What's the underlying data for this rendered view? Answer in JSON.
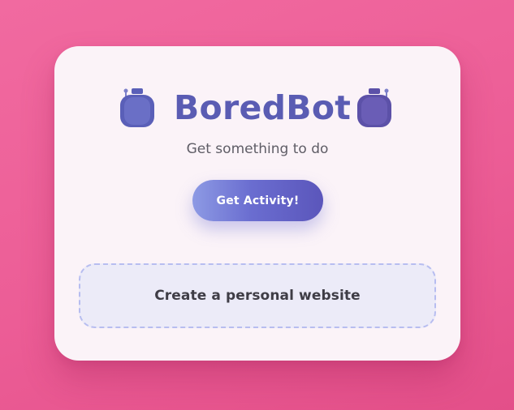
{
  "app": {
    "title": "BoredBot",
    "subtitle": "Get something to do"
  },
  "icons": {
    "left": "robot-icon",
    "right": "robot-icon"
  },
  "actions": {
    "get_activity_label": "Get Activity!"
  },
  "activity": {
    "text": "Create a personal website"
  },
  "colors": {
    "background": "#ec5d96",
    "card": "#fbf3f8",
    "title": "#5a5cb3",
    "button_start": "#8d9ae4",
    "button_end": "#5b56bb",
    "activity_bg": "#ecebf8",
    "activity_border": "#b7bdf0"
  }
}
